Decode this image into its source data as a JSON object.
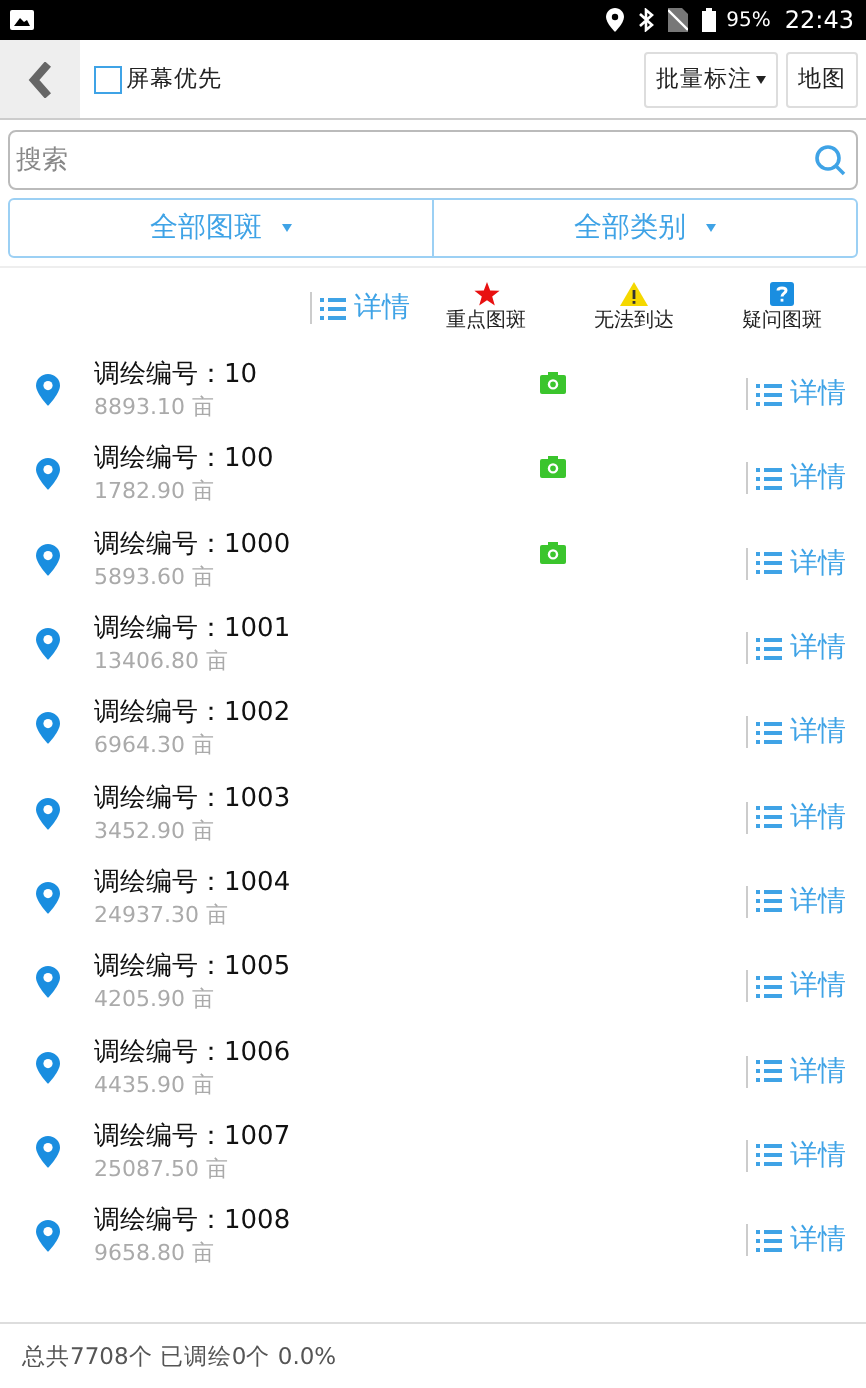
{
  "status_bar": {
    "battery": "95%",
    "time": "22:43"
  },
  "header": {
    "screen_first": {
      "label": "屏幕优先",
      "checked": false
    },
    "batch_button": "批量标注",
    "map_button": "地图"
  },
  "search": {
    "placeholder": "搜索"
  },
  "filters": [
    {
      "label": "全部图斑"
    },
    {
      "label": "全部类别"
    }
  ],
  "legend": {
    "detail": "详情",
    "items": [
      {
        "kind": "star",
        "label": "重点图斑"
      },
      {
        "kind": "warning",
        "label": "无法到达"
      },
      {
        "kind": "question",
        "label": "疑问图斑"
      }
    ]
  },
  "rows": [
    {
      "title": "调绘编号：10",
      "area": "8893.10 亩",
      "photo": true,
      "detail": "详情"
    },
    {
      "title": "调绘编号：100",
      "area": "1782.90 亩",
      "photo": true,
      "detail": "详情"
    },
    {
      "title": "调绘编号：1000",
      "area": "5893.60 亩",
      "photo": true,
      "detail": "详情"
    },
    {
      "title": "调绘编号：1001",
      "area": "13406.80 亩",
      "photo": false,
      "detail": "详情"
    },
    {
      "title": "调绘编号：1002",
      "area": "6964.30 亩",
      "photo": false,
      "detail": "详情"
    },
    {
      "title": "调绘编号：1003",
      "area": "3452.90 亩",
      "photo": false,
      "detail": "详情"
    },
    {
      "title": "调绘编号：1004",
      "area": "24937.30 亩",
      "photo": false,
      "detail": "详情"
    },
    {
      "title": "调绘编号：1005",
      "area": "4205.90 亩",
      "photo": false,
      "detail": "详情"
    },
    {
      "title": "调绘编号：1006",
      "area": "4435.90 亩",
      "photo": false,
      "detail": "详情"
    },
    {
      "title": "调绘编号：1007",
      "area": "25087.50 亩",
      "photo": false,
      "detail": "详情"
    },
    {
      "title": "调绘编号：1008",
      "area": "9658.80 亩",
      "photo": false,
      "detail": "详情"
    }
  ],
  "footer": "总共7708个 已调绘0个 0.0%"
}
